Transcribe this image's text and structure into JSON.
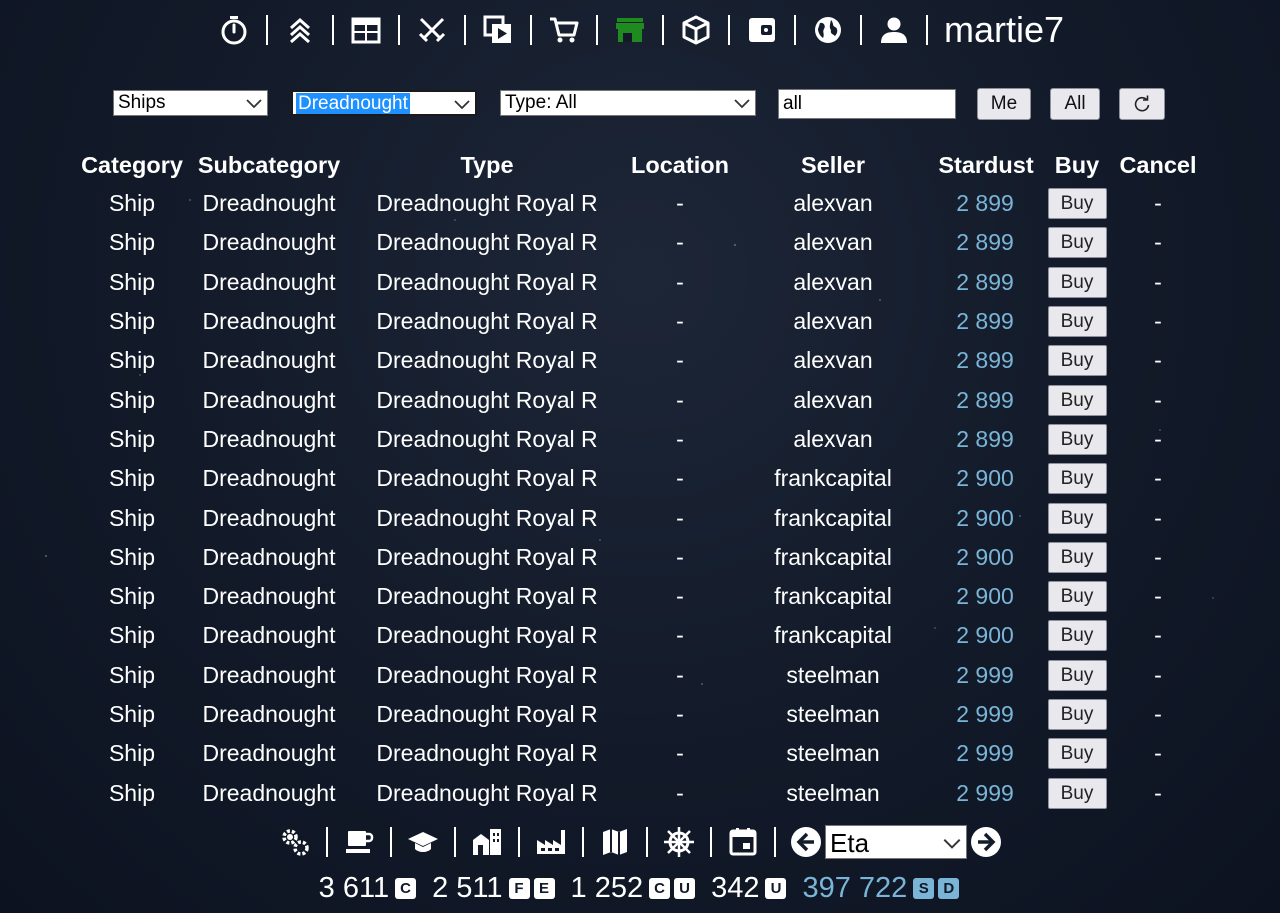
{
  "header": {
    "username": "martie7",
    "nav": [
      {
        "icon": "stopwatch-icon",
        "active": false
      },
      {
        "icon": "chevrons-up-icon",
        "active": false
      },
      {
        "icon": "calendar-icon",
        "active": false
      },
      {
        "icon": "crossed-swords-icon",
        "active": false
      },
      {
        "icon": "card-play-icon",
        "active": false
      },
      {
        "icon": "cart-icon",
        "active": false
      },
      {
        "icon": "shop-icon",
        "active": true
      },
      {
        "icon": "cube-icon",
        "active": false
      },
      {
        "icon": "wallet-icon",
        "active": false
      },
      {
        "icon": "globe-icon",
        "active": false
      },
      {
        "icon": "user-icon",
        "active": false
      }
    ],
    "active_color": "#1f8a1f"
  },
  "filters": {
    "category": "Ships",
    "subcategory": "Dreadnought",
    "type": "Type: All",
    "search": "all",
    "me_label": "Me",
    "all_label": "All",
    "refresh_icon": "refresh-icon"
  },
  "table": {
    "headers": {
      "category": "Category",
      "subcategory": "Subcategory",
      "type": "Type",
      "location": "Location",
      "seller": "Seller",
      "stardust": "Stardust",
      "buy": "Buy",
      "cancel": "Cancel"
    },
    "buy_label": "Buy",
    "rows": [
      {
        "category": "Ship",
        "subcategory": "Dreadnought",
        "type": "Dreadnought Royal R",
        "location": "-",
        "seller": "alexvan",
        "stardust": "2 899",
        "cancel": "-"
      },
      {
        "category": "Ship",
        "subcategory": "Dreadnought",
        "type": "Dreadnought Royal R",
        "location": "-",
        "seller": "alexvan",
        "stardust": "2 899",
        "cancel": "-"
      },
      {
        "category": "Ship",
        "subcategory": "Dreadnought",
        "type": "Dreadnought Royal R",
        "location": "-",
        "seller": "alexvan",
        "stardust": "2 899",
        "cancel": "-"
      },
      {
        "category": "Ship",
        "subcategory": "Dreadnought",
        "type": "Dreadnought Royal R",
        "location": "-",
        "seller": "alexvan",
        "stardust": "2 899",
        "cancel": "-"
      },
      {
        "category": "Ship",
        "subcategory": "Dreadnought",
        "type": "Dreadnought Royal R",
        "location": "-",
        "seller": "alexvan",
        "stardust": "2 899",
        "cancel": "-"
      },
      {
        "category": "Ship",
        "subcategory": "Dreadnought",
        "type": "Dreadnought Royal R",
        "location": "-",
        "seller": "alexvan",
        "stardust": "2 899",
        "cancel": "-"
      },
      {
        "category": "Ship",
        "subcategory": "Dreadnought",
        "type": "Dreadnought Royal R",
        "location": "-",
        "seller": "alexvan",
        "stardust": "2 899",
        "cancel": "-"
      },
      {
        "category": "Ship",
        "subcategory": "Dreadnought",
        "type": "Dreadnought Royal R",
        "location": "-",
        "seller": "frankcapital",
        "stardust": "2 900",
        "cancel": "-"
      },
      {
        "category": "Ship",
        "subcategory": "Dreadnought",
        "type": "Dreadnought Royal R",
        "location": "-",
        "seller": "frankcapital",
        "stardust": "2 900",
        "cancel": "-"
      },
      {
        "category": "Ship",
        "subcategory": "Dreadnought",
        "type": "Dreadnought Royal R",
        "location": "-",
        "seller": "frankcapital",
        "stardust": "2 900",
        "cancel": "-"
      },
      {
        "category": "Ship",
        "subcategory": "Dreadnought",
        "type": "Dreadnought Royal R",
        "location": "-",
        "seller": "frankcapital",
        "stardust": "2 900",
        "cancel": "-"
      },
      {
        "category": "Ship",
        "subcategory": "Dreadnought",
        "type": "Dreadnought Royal R",
        "location": "-",
        "seller": "frankcapital",
        "stardust": "2 900",
        "cancel": "-"
      },
      {
        "category": "Ship",
        "subcategory": "Dreadnought",
        "type": "Dreadnought Royal R",
        "location": "-",
        "seller": "steelman",
        "stardust": "2 999",
        "cancel": "-"
      },
      {
        "category": "Ship",
        "subcategory": "Dreadnought",
        "type": "Dreadnought Royal R",
        "location": "-",
        "seller": "steelman",
        "stardust": "2 999",
        "cancel": "-"
      },
      {
        "category": "Ship",
        "subcategory": "Dreadnought",
        "type": "Dreadnought Royal R",
        "location": "-",
        "seller": "steelman",
        "stardust": "2 999",
        "cancel": "-"
      },
      {
        "category": "Ship",
        "subcategory": "Dreadnought",
        "type": "Dreadnought Royal R",
        "location": "-",
        "seller": "steelman",
        "stardust": "2 999",
        "cancel": "-"
      }
    ]
  },
  "footer": {
    "nav": [
      {
        "icon": "gears-icon"
      },
      {
        "icon": "coffee-mug-icon"
      },
      {
        "icon": "graduation-cap-icon"
      },
      {
        "icon": "buildings-icon"
      },
      {
        "icon": "factory-icon"
      },
      {
        "icon": "map-icon"
      },
      {
        "icon": "ship-wheel-icon"
      },
      {
        "icon": "calendar-day-icon"
      }
    ],
    "planet_select": "Eta",
    "prev_icon": "arrow-left-circle-icon",
    "next_icon": "arrow-right-circle-icon",
    "resources": [
      {
        "value": "3 611",
        "badges": [
          "C"
        ],
        "color": "#ffffff"
      },
      {
        "value": "2 511",
        "badges": [
          "F",
          "E"
        ],
        "color": "#ffffff"
      },
      {
        "value": "1 252",
        "badges": [
          "C",
          "U"
        ],
        "color": "#ffffff"
      },
      {
        "value": "342",
        "badges": [
          "U"
        ],
        "color": "#ffffff"
      },
      {
        "value": "397 722",
        "badges": [
          "S",
          "D"
        ],
        "color": "#7ab5d8"
      }
    ]
  },
  "colors": {
    "stardust": "#7ab5d8",
    "background": "#121a29",
    "focus_highlight": "#1e90ff"
  }
}
